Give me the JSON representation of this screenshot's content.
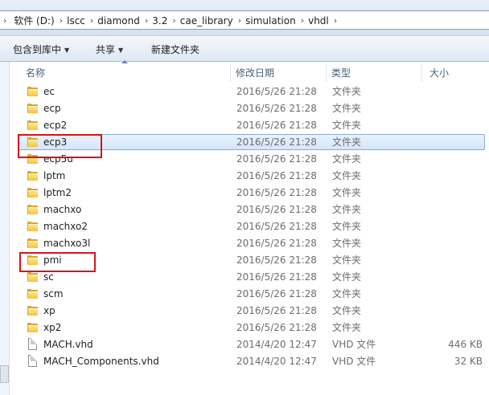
{
  "address": {
    "crumbs": [
      "软件 (D:)",
      "lscc",
      "diamond",
      "3.2",
      "cae_library",
      "simulation",
      "vhdl"
    ]
  },
  "toolbar": {
    "include_library_label": "包含到库中",
    "share_label": "共享",
    "new_folder_label": "新建文件夹"
  },
  "columns": {
    "name": "名称",
    "date_modified": "修改日期",
    "type": "类型",
    "size": "大小"
  },
  "files": [
    {
      "name": "ec",
      "date": "2016/5/26 21:28",
      "type": "文件夹",
      "size": "",
      "icon": "folder-icon"
    },
    {
      "name": "ecp",
      "date": "2016/5/26 21:28",
      "type": "文件夹",
      "size": "",
      "icon": "folder-icon"
    },
    {
      "name": "ecp2",
      "date": "2016/5/26 21:28",
      "type": "文件夹",
      "size": "",
      "icon": "folder-icon"
    },
    {
      "name": "ecp3",
      "date": "2016/5/26 21:28",
      "type": "文件夹",
      "size": "",
      "icon": "folder-icon",
      "selected": true,
      "annotated": true
    },
    {
      "name": "ecp5u",
      "date": "2016/5/26 21:28",
      "type": "文件夹",
      "size": "",
      "icon": "folder-icon"
    },
    {
      "name": "lptm",
      "date": "2016/5/26 21:28",
      "type": "文件夹",
      "size": "",
      "icon": "folder-icon"
    },
    {
      "name": "lptm2",
      "date": "2016/5/26 21:28",
      "type": "文件夹",
      "size": "",
      "icon": "folder-icon"
    },
    {
      "name": "machxo",
      "date": "2016/5/26 21:28",
      "type": "文件夹",
      "size": "",
      "icon": "folder-icon"
    },
    {
      "name": "machxo2",
      "date": "2016/5/26 21:28",
      "type": "文件夹",
      "size": "",
      "icon": "folder-icon"
    },
    {
      "name": "machxo3l",
      "date": "2016/5/26 21:28",
      "type": "文件夹",
      "size": "",
      "icon": "folder-icon"
    },
    {
      "name": "pmi",
      "date": "2016/5/26 21:28",
      "type": "文件夹",
      "size": "",
      "icon": "folder-icon",
      "annotated": true
    },
    {
      "name": "sc",
      "date": "2016/5/26 21:28",
      "type": "文件夹",
      "size": "",
      "icon": "folder-icon"
    },
    {
      "name": "scm",
      "date": "2016/5/26 21:28",
      "type": "文件夹",
      "size": "",
      "icon": "folder-icon"
    },
    {
      "name": "xp",
      "date": "2016/5/26 21:28",
      "type": "文件夹",
      "size": "",
      "icon": "folder-icon"
    },
    {
      "name": "xp2",
      "date": "2016/5/26 21:28",
      "type": "文件夹",
      "size": "",
      "icon": "folder-icon"
    },
    {
      "name": "MACH.vhd",
      "date": "2014/4/20 12:47",
      "type": "VHD 文件",
      "size": "446 KB",
      "icon": "file-icon"
    },
    {
      "name": "MACH_Components.vhd",
      "date": "2014/4/20 12:47",
      "type": "VHD 文件",
      "size": "32 KB",
      "icon": "file-icon"
    }
  ],
  "colors": {
    "annotation_red": "#d4141b",
    "selection_border": "#84acdd",
    "folder_yellow": "#f2c24a"
  }
}
